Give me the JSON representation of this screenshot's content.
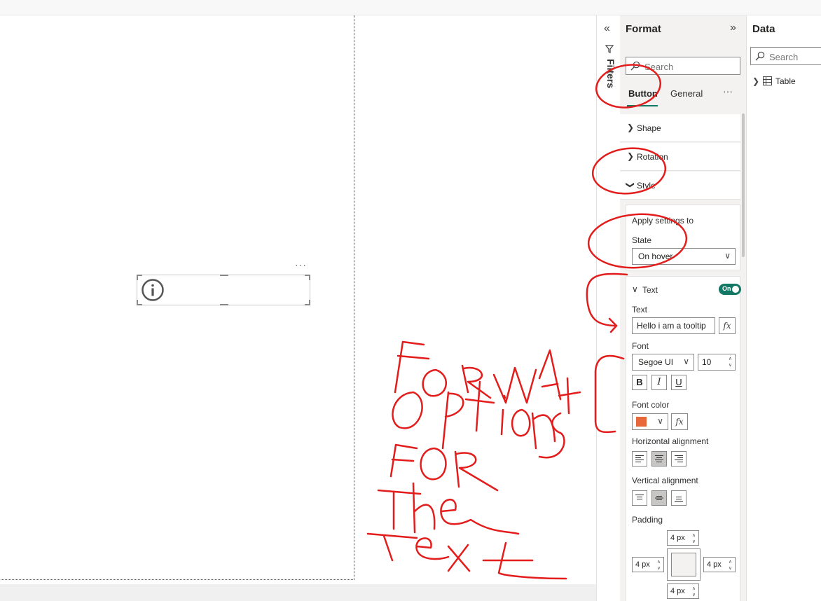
{
  "canvas": {
    "more_options": "···"
  },
  "filters": {
    "label": "Filters",
    "collapse_icon": "«"
  },
  "format_pane": {
    "title": "Format",
    "expand_icon": "»",
    "search_placeholder": "Search",
    "tabs": [
      {
        "label": "Button",
        "active": true
      },
      {
        "label": "General",
        "active": false
      }
    ],
    "more_options": "···",
    "sections": [
      {
        "label": "Shape",
        "expanded": false
      },
      {
        "label": "Rotation",
        "expanded": false
      },
      {
        "label": "Style",
        "expanded": true
      }
    ],
    "apply_settings": {
      "title": "Apply settings to",
      "state_label": "State",
      "state_value": "On hover"
    },
    "text_card": {
      "title": "Text",
      "toggle_label": "On",
      "text_label": "Text",
      "text_value": "Hello i am a tooltip",
      "fx": "fx",
      "font_label": "Font",
      "font_family": "Segoe UI",
      "font_size": "10",
      "bold": "B",
      "italic": "I",
      "underline": "U",
      "font_color_label": "Font color",
      "font_color": "#e8683a",
      "horizontal_alignment_label": "Horizontal alignment",
      "horizontal_alignment": "center",
      "vertical_alignment_label": "Vertical alignment",
      "vertical_alignment": "middle",
      "padding_label": "Padding",
      "padding_top": "4 px",
      "padding_left": "4 px",
      "padding_right": "4 px",
      "padding_bottom": "4 px"
    }
  },
  "data_pane": {
    "title": "Data",
    "search_placeholder": "Search",
    "items": [
      {
        "label": "Table"
      }
    ]
  },
  "colors": {
    "accent": "#117865",
    "annotation": "#e31c1c"
  },
  "annotation_words": [
    "Format",
    "options",
    "FOR",
    "the",
    "Text"
  ]
}
